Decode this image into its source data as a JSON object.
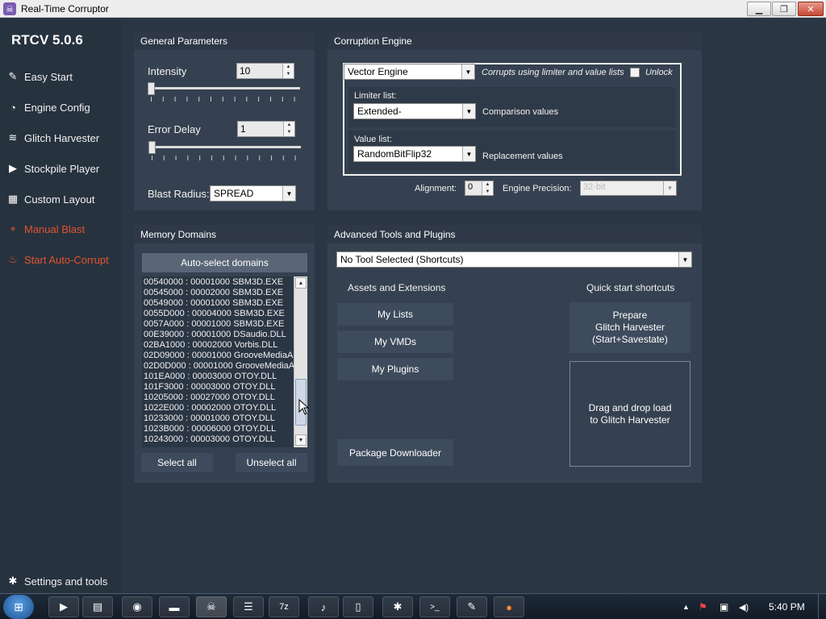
{
  "window": {
    "title": "Real-Time Corruptor",
    "minimize": "▁",
    "restore": "❐",
    "close": "✕",
    "app_icon": "☠"
  },
  "sidebar": {
    "brand": "RTCV 5.0.6",
    "items": [
      {
        "label": "Easy Start",
        "icon": "wand-icon",
        "glyph": "✎"
      },
      {
        "label": "Engine Config",
        "icon": "gauge-icon",
        "glyph": "◔"
      },
      {
        "label": "Glitch Harvester",
        "icon": "layers-icon",
        "glyph": "≋"
      },
      {
        "label": "Stockpile Player",
        "icon": "play-icon",
        "glyph": "▶"
      },
      {
        "label": "Custom Layout",
        "icon": "grid-icon",
        "glyph": "▦"
      },
      {
        "label": "Manual Blast",
        "icon": "crosshair-icon",
        "glyph": "⌖"
      },
      {
        "label": "Start Auto-Corrupt",
        "icon": "flame-icon",
        "glyph": "♨"
      }
    ],
    "settings": {
      "label": "Settings and tools",
      "glyph": "✱"
    }
  },
  "general": {
    "header": "General Parameters",
    "intensity_label": "Intensity",
    "intensity_value": "10",
    "error_delay_label": "Error Delay",
    "error_delay_value": "1",
    "blast_radius_label": "Blast Radius:",
    "blast_radius_value": "SPREAD"
  },
  "engine": {
    "header": "Corruption Engine",
    "engine_value": "Vector Engine",
    "engine_desc": "Corrupts using limiter and value lists",
    "unlock_label": "Unlock",
    "limiter_label": "Limiter list:",
    "limiter_value": "Extended-",
    "limiter_desc": "Comparison values",
    "value_label": "Value list:",
    "value_value": "RandomBitFlip32",
    "value_desc": "Replacement values",
    "alignment_label": "Alignment:",
    "alignment_value": "0",
    "precision_label": "Engine Precision:",
    "precision_value": "32-bit"
  },
  "memory": {
    "header": "Memory Domains",
    "auto_select": "Auto-select domains",
    "rows": [
      "00540000 : 00001000 SBM3D.EXE",
      "00545000 : 00002000 SBM3D.EXE",
      "00549000 : 00001000 SBM3D.EXE",
      "0055D000 : 00004000 SBM3D.EXE",
      "0057A000 : 00001000 SBM3D.EXE",
      "00E39000 : 00001000 DSaudio.DLL",
      "02BA1000 : 00002000 Vorbis.DLL",
      "02D09000 : 00001000 GrooveMediaA",
      "02D0D000 : 00001000 GrooveMediaA",
      "101EA000 : 00003000 OTOY.DLL",
      "101F3000 : 00003000 OTOY.DLL",
      "10205000 : 00027000 OTOY.DLL",
      "1022E000 : 00002000 OTOY.DLL",
      "10233000 : 00001000 OTOY.DLL",
      "1023B000 : 00006000 OTOY.DLL",
      "10243000 : 00003000 OTOY.DLL"
    ],
    "select_all": "Select all",
    "unselect_all": "Unselect all"
  },
  "advanced": {
    "header": "Advanced Tools and Plugins",
    "tool_select": "No Tool Selected (Shortcuts)",
    "assets_header": "Assets and Extensions",
    "my_lists": "My Lists",
    "my_vmds": "My VMDs",
    "my_plugins": "My Plugins",
    "package_downloader": "Package Downloader",
    "quick_header": "Quick start shortcuts",
    "prepare_line1": "Prepare",
    "prepare_line2": "Glitch Harvester",
    "prepare_line3": "(Start+Savestate)",
    "drop_line1": "Drag and drop load",
    "drop_line2": "to Glitch Harvester"
  },
  "taskbar": {
    "clock": "5:40 PM",
    "start_glyph": "⊞",
    "items": [
      {
        "icon": "media-player-icon",
        "glyph": "▶"
      },
      {
        "icon": "folder-icon",
        "glyph": "▤"
      },
      {
        "icon": "chrome-icon",
        "glyph": "◉"
      },
      {
        "icon": "monitor-icon",
        "glyph": "▬"
      },
      {
        "icon": "rtc-icon",
        "glyph": "☠"
      },
      {
        "icon": "notepad-icon",
        "glyph": "☰"
      },
      {
        "icon": "archive-icon",
        "glyph": "7z"
      },
      {
        "icon": "mic-icon",
        "glyph": "♪"
      },
      {
        "icon": "document-icon",
        "glyph": "▯"
      },
      {
        "icon": "gear-app-icon",
        "glyph": "✱"
      },
      {
        "icon": "terminal-icon",
        "glyph": ">_"
      },
      {
        "icon": "editor-icon",
        "glyph": "✎"
      },
      {
        "icon": "emulator-icon",
        "glyph": "●"
      }
    ],
    "tray": {
      "show_hidden": "▲",
      "flag": "⚑",
      "network": "▣",
      "volume": "◀)"
    }
  }
}
